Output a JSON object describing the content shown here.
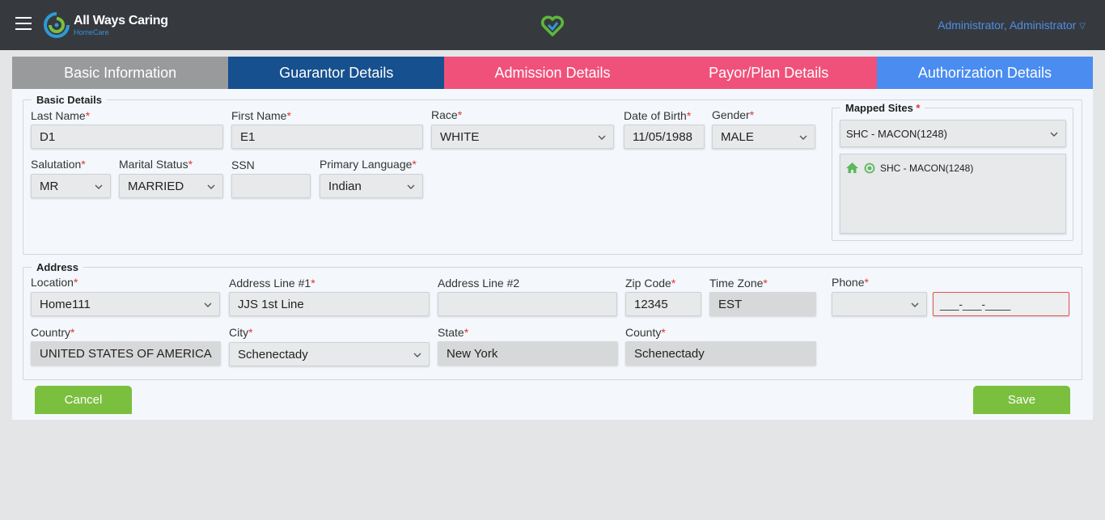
{
  "header": {
    "brand": "All Ways Caring",
    "brand_sub": "HomeCare",
    "user": "Administrator, Administrator"
  },
  "tabs": [
    {
      "label": "Basic Information"
    },
    {
      "label": "Guarantor Details"
    },
    {
      "label": "Admission Details"
    },
    {
      "label": "Payor/Plan Details"
    },
    {
      "label": "Authorization Details"
    }
  ],
  "basic_details": {
    "legend": "Basic Details",
    "last_name": {
      "label": "Last Name",
      "value": "D1"
    },
    "first_name": {
      "label": "First Name",
      "value": "E1"
    },
    "race": {
      "label": "Race",
      "value": "WHITE"
    },
    "dob": {
      "label": "Date of Birth",
      "value": "11/05/1988"
    },
    "gender": {
      "label": "Gender",
      "value": "MALE"
    },
    "salutation": {
      "label": "Salutation",
      "value": "MR"
    },
    "marital_status": {
      "label": "Marital Status",
      "value": "MARRIED"
    },
    "ssn": {
      "label": "SSN",
      "value": ""
    },
    "primary_language": {
      "label": "Primary Language",
      "value": "Indian"
    }
  },
  "mapped_sites": {
    "legend": "Mapped Sites",
    "selected": "SHC - MACON(1248)",
    "items": [
      {
        "label": "SHC - MACON(1248)"
      }
    ]
  },
  "address": {
    "legend": "Address",
    "location": {
      "label": "Location",
      "value": "Home111"
    },
    "line1": {
      "label": "Address Line #1",
      "value": "JJS 1st Line"
    },
    "line2": {
      "label": "Address Line #2",
      "value": ""
    },
    "zip": {
      "label": "Zip Code",
      "value": "12345"
    },
    "timezone": {
      "label": "Time Zone",
      "value": "EST"
    },
    "phone": {
      "label": "Phone",
      "type_value": "",
      "number_placeholder": "___-___-____"
    },
    "country": {
      "label": "Country",
      "value": "UNITED STATES OF AMERICA"
    },
    "city": {
      "label": "City",
      "value": "Schenectady"
    },
    "state": {
      "label": "State",
      "value": "New York"
    },
    "county": {
      "label": "County",
      "value": "Schenectady"
    }
  },
  "actions": {
    "cancel": "Cancel",
    "save": "Save"
  },
  "required_mark": "*",
  "colors": {
    "topbar": "#363a3f",
    "tab_basic": "#999a9b",
    "tab_guarantor": "#16508f",
    "tab_pink": "#f0517a",
    "tab_auth": "#4a8cf0",
    "button_green": "#7bbf3f",
    "user_link": "#4f8ee3"
  }
}
